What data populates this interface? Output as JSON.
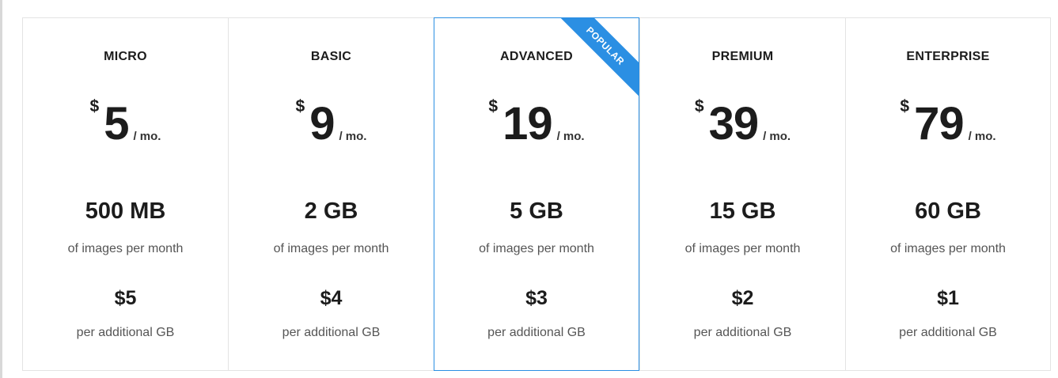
{
  "plans": [
    {
      "name": "MICRO",
      "currency": "$",
      "amount": "5",
      "period": "/ mo.",
      "quota": "500 MB",
      "quota_desc": "of images per month",
      "extra_price": "$5",
      "extra_desc": "per additional GB"
    },
    {
      "name": "BASIC",
      "currency": "$",
      "amount": "9",
      "period": "/ mo.",
      "quota": "2 GB",
      "quota_desc": "of images per month",
      "extra_price": "$4",
      "extra_desc": "per additional GB"
    },
    {
      "name": "ADVANCED",
      "currency": "$",
      "amount": "19",
      "period": "/ mo.",
      "quota": "5 GB",
      "quota_desc": "of images per month",
      "extra_price": "$3",
      "extra_desc": "per additional GB",
      "badge": "POPULAR"
    },
    {
      "name": "PREMIUM",
      "currency": "$",
      "amount": "39",
      "period": "/ mo.",
      "quota": "15 GB",
      "quota_desc": "of images per month",
      "extra_price": "$2",
      "extra_desc": "per additional GB"
    },
    {
      "name": "ENTERPRISE",
      "currency": "$",
      "amount": "79",
      "period": "/ mo.",
      "quota": "60 GB",
      "quota_desc": "of images per month",
      "extra_price": "$1",
      "extra_desc": "per additional GB"
    }
  ],
  "colors": {
    "accent": "#2b8fe3",
    "border": "#e3e3e3",
    "text": "#1c1c1c",
    "muted": "#555555"
  }
}
